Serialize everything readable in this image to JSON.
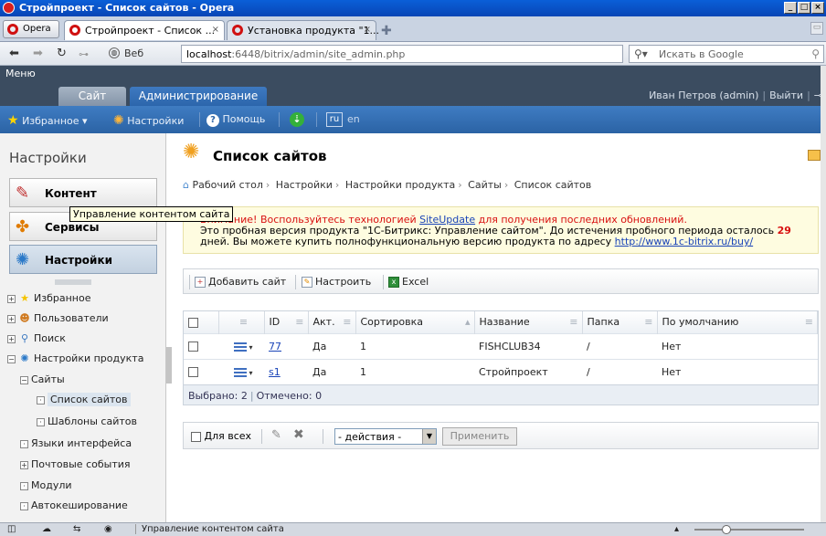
{
  "window": {
    "title": "Стройпроект - Список сайтов - Opera",
    "min": "_",
    "max": "□",
    "close": "×"
  },
  "browser": {
    "opera_button": "Opera",
    "tabs": [
      {
        "label": "Стройпроект - Список ...",
        "close": "×"
      },
      {
        "label": "Установка продукта \"1...",
        "close": "×"
      }
    ],
    "web_button": "Веб",
    "url_host": "localhost",
    "url_rest": ":6448/bitrix/admin/site_admin.php",
    "search_placeholder": "Искать в Google"
  },
  "admin": {
    "menu_label": "Меню",
    "tab_site": "Сайт",
    "tab_admin": "Администрирование",
    "user": "Иван Петров (admin)",
    "logout": "Выйти",
    "favorites": "Избранное",
    "settings": "Настройки",
    "help": "Помощь",
    "lang_ru": "ru",
    "lang_en": "en"
  },
  "sidebar": {
    "title": "Настройки",
    "buttons": [
      "Контент",
      "Сервисы",
      "Настройки"
    ],
    "tree": [
      "Избранное",
      "Пользователи",
      "Поиск",
      "Настройки продукта",
      "Сайты",
      "Список сайтов",
      "Шаблоны сайтов",
      "Языки интерфейса",
      "Почтовые события",
      "Модули",
      "Автокеширование"
    ]
  },
  "tooltip": "Управление контентом сайта",
  "main": {
    "title": "Список сайтов",
    "breadcrumb": [
      "Рабочий стол",
      "Настройки",
      "Настройки продукта",
      "Сайты",
      "Список сайтов"
    ],
    "notice": {
      "warn_prefix": "Внимание! Воспользуйтесь технологией ",
      "warn_link": "SiteUpdate",
      "warn_suffix": " для получения последних обновлений.",
      "line2": "Это пробная версия продукта \"1С-Битрикс: Управление сайтом\". До истечения пробного периода осталось ",
      "days": "29",
      "line3": "дней. Вы можете купить полнофункциональную версию продукта по адресу ",
      "link": "http://www.1c-bitrix.ru/buy/"
    },
    "toolbar": {
      "add": "Добавить сайт",
      "configure": "Настроить",
      "excel": "Excel"
    },
    "columns": [
      "ID",
      "Акт.",
      "Сортировка",
      "Название",
      "Папка",
      "По умолчанию"
    ],
    "rows": [
      {
        "id": "77",
        "active": "Да",
        "sort": "1",
        "name": "FISHCLUB34",
        "folder": "/",
        "default": "Нет"
      },
      {
        "id": "s1",
        "active": "Да",
        "sort": "1",
        "name": "Стройпроект",
        "folder": "/",
        "default": "Нет"
      }
    ],
    "footer": {
      "selected": "Выбрано: 2",
      "checked": "Отмечено: 0"
    },
    "actions": {
      "for_all": "Для всех",
      "select": "- действия -",
      "apply": "Применить"
    }
  },
  "status": {
    "text": "Управление контентом сайта"
  }
}
